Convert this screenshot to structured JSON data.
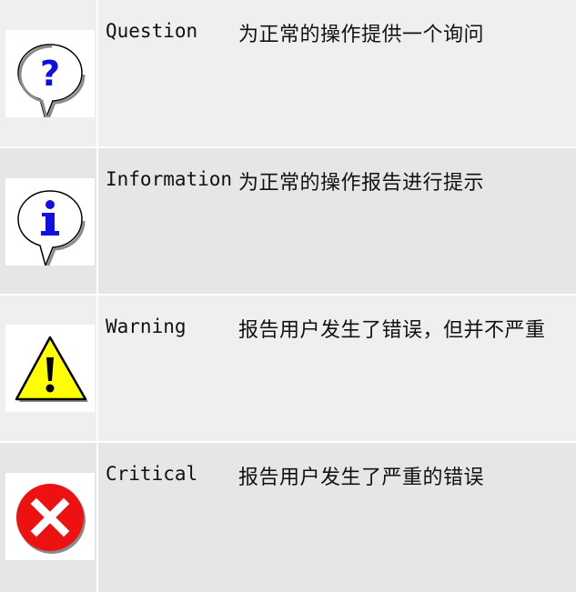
{
  "rows": [
    {
      "name": "Question",
      "description": "为正常的操作提供一个询问",
      "icon": "question-icon"
    },
    {
      "name": "Information",
      "description": "为正常的操作报告进行提示",
      "icon": "information-icon"
    },
    {
      "name": "Warning",
      "description": "报告用户发生了错误，但并不严重",
      "icon": "warning-icon"
    },
    {
      "name": "Critical",
      "description": "报告用户发生了严重的错误",
      "icon": "critical-icon"
    }
  ],
  "colors": {
    "row_light": "#efefef",
    "row_dark": "#e6e6e6",
    "question_glyph": "#1010e0",
    "warning_fill": "#ffff00",
    "critical_fill": "#ee1111"
  }
}
